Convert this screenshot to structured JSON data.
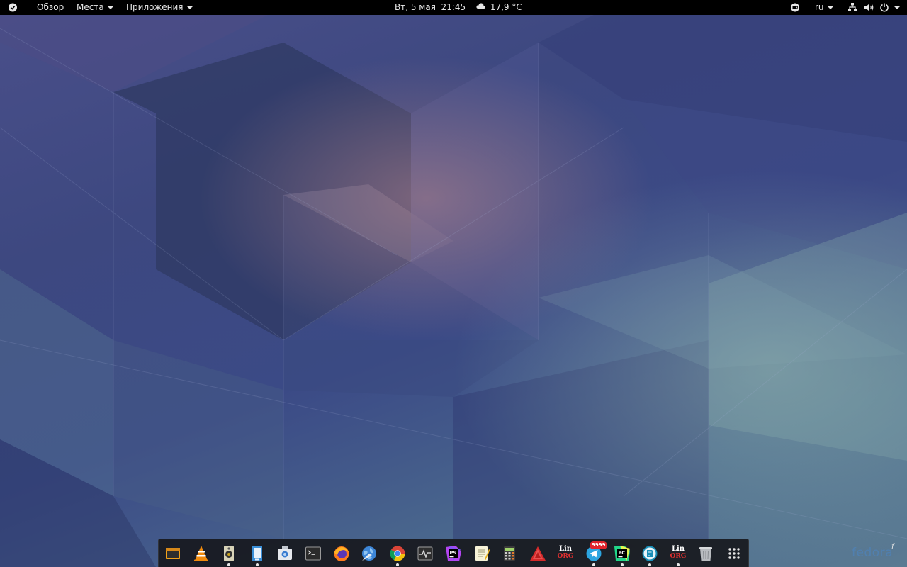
{
  "topbar": {
    "activities_label": "Обзор",
    "places_label": "Места",
    "apps_label": "Приложения",
    "clock": "Вт, 5 мая  21:45",
    "weather": "17,9 °C",
    "keyboard_layout": "ru"
  },
  "topbar_icons": [
    "fedora-check-icon",
    "weather-cloud-icon",
    "coffee-cup-icon",
    "network-icon",
    "volume-icon",
    "power-icon"
  ],
  "dock": {
    "apps": [
      {
        "name": "files-app",
        "running": false
      },
      {
        "name": "vlc",
        "running": false
      },
      {
        "name": "rhythmbox",
        "running": true
      },
      {
        "name": "document-viewer",
        "running": true
      },
      {
        "name": "screenshot-tool",
        "running": false
      },
      {
        "name": "terminal",
        "running": false
      },
      {
        "name": "firefox",
        "running": false
      },
      {
        "name": "web-browser",
        "running": false
      },
      {
        "name": "chrome",
        "running": true
      },
      {
        "name": "system-monitor",
        "running": false
      },
      {
        "name": "phpstorm",
        "running": false
      },
      {
        "name": "text-editor",
        "running": false
      },
      {
        "name": "calculator",
        "running": false
      },
      {
        "name": "red-triangle-app",
        "running": false
      },
      {
        "name": "linux-org-app",
        "running": false
      },
      {
        "name": "telegram",
        "running": true,
        "badge": "9999"
      },
      {
        "name": "pycharm",
        "running": true
      },
      {
        "name": "notes-app",
        "running": true
      },
      {
        "name": "linux-org-app-2",
        "running": true
      },
      {
        "name": "trash",
        "running": false
      },
      {
        "name": "show-applications",
        "running": false
      }
    ],
    "lin_label": "Lin",
    "lin_sub": "ORG"
  },
  "branding": {
    "fedora_logo": "fedora",
    "fedora_corner": "f"
  },
  "colors": {
    "topbar_bg": "#000000",
    "dock_bg": "#141418",
    "wallpaper_base": "#3a4478"
  }
}
